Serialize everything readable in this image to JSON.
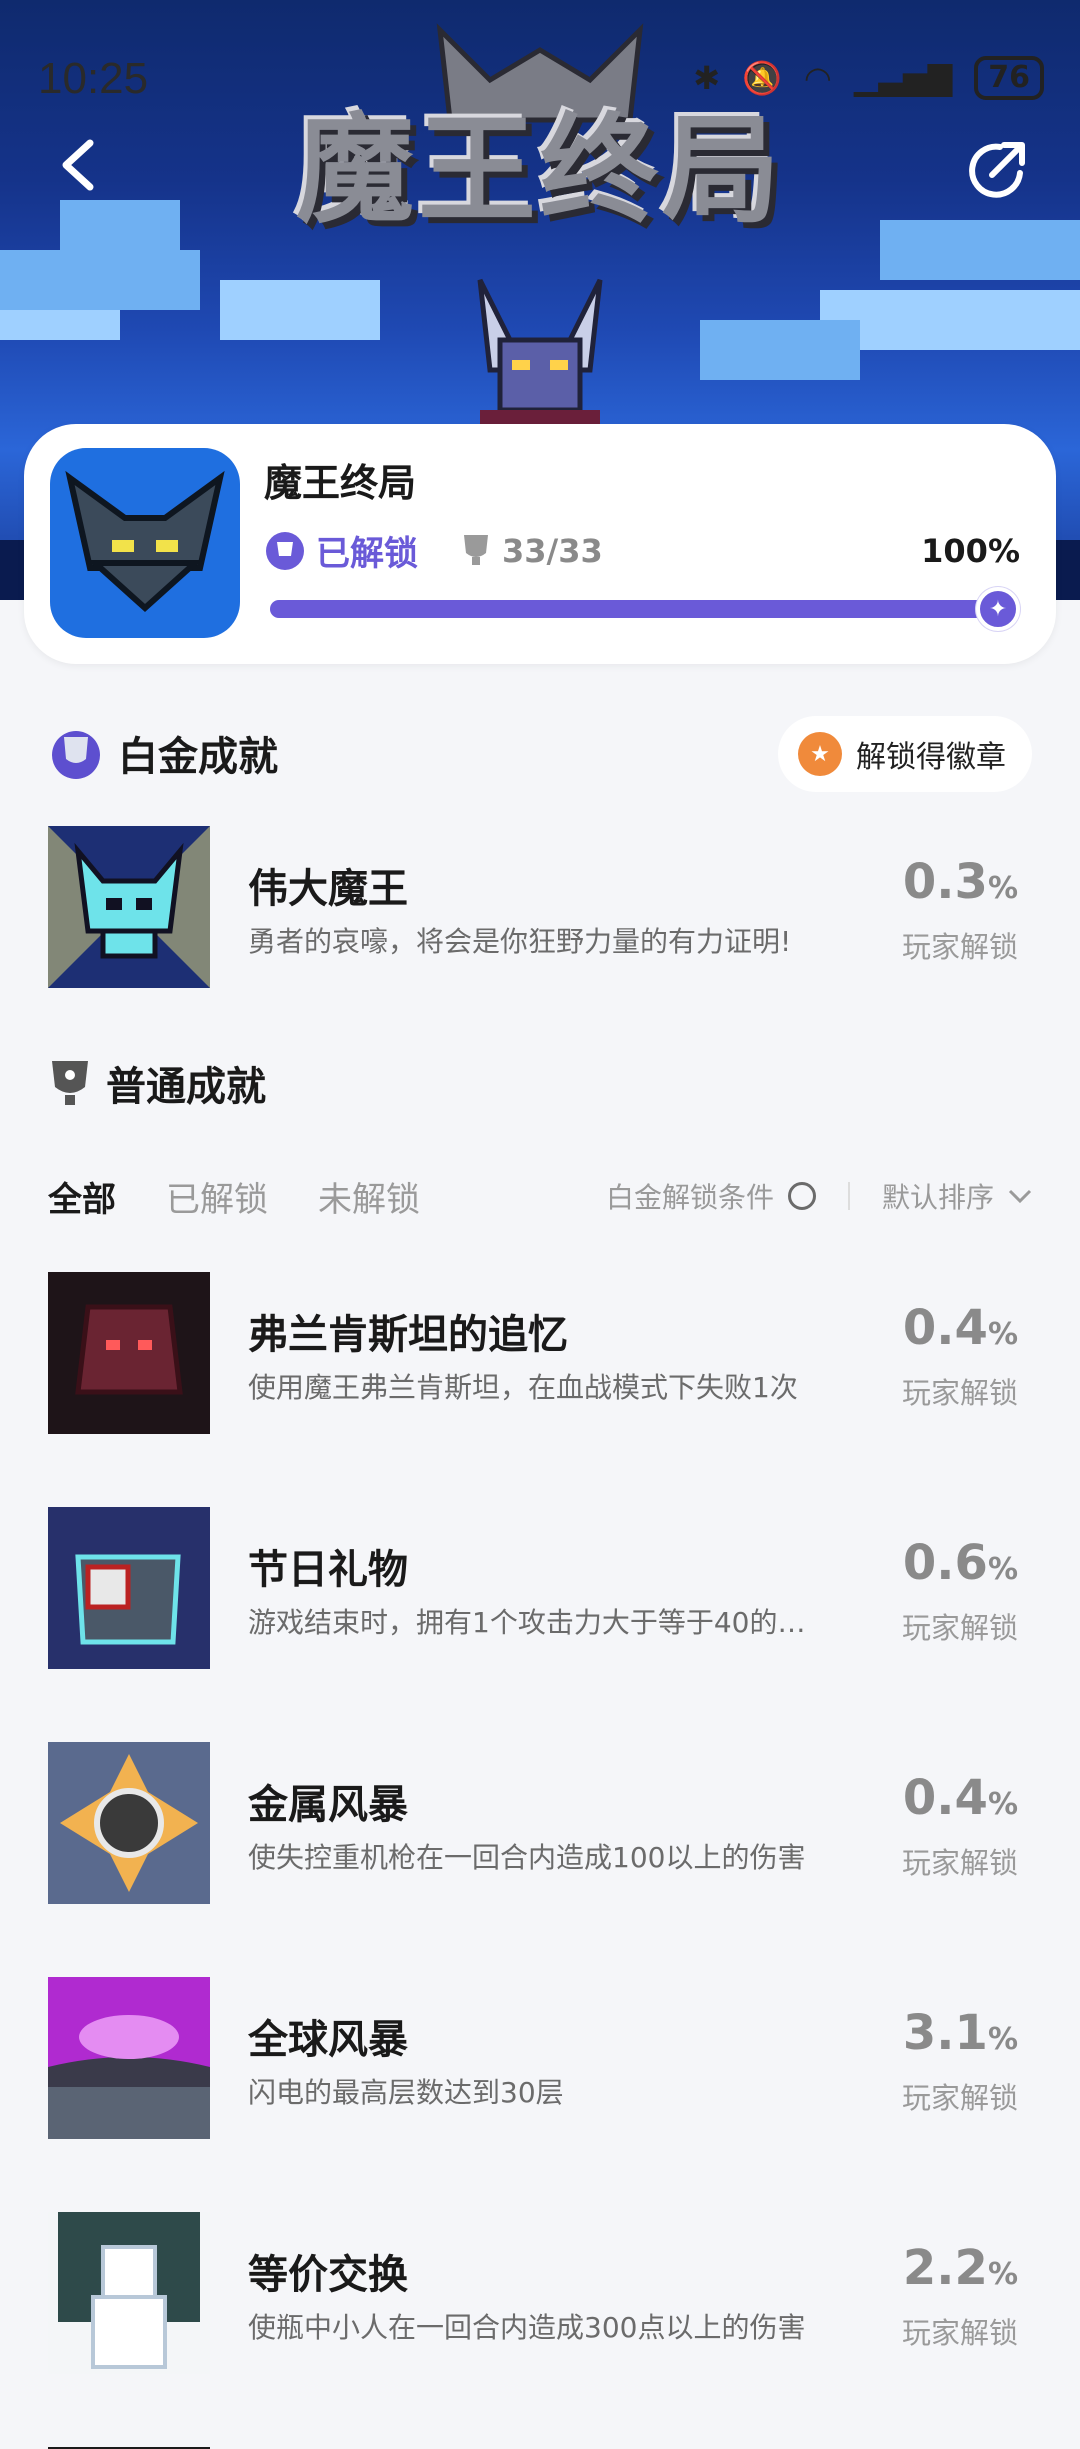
{
  "status_bar": {
    "time": "10:25",
    "battery": "76"
  },
  "hero": {
    "title": "魔王终局"
  },
  "card": {
    "title": "魔王终局",
    "unlocked_label": "已解锁",
    "trophies": "33/33",
    "percent": "100%",
    "progress": 1.0
  },
  "platinum": {
    "heading": "白金成就",
    "badge_button": "解锁得徽章",
    "item": {
      "name": "伟大魔王",
      "desc": "勇者的哀嚎，将会是你狂野力量的有力证明!",
      "rate": "0.3",
      "unit": "%",
      "label": "玩家解锁"
    }
  },
  "normal": {
    "heading": "普通成就",
    "tabs": [
      "全部",
      "已解锁",
      "未解锁"
    ],
    "condition_label": "白金解锁条件",
    "sort_label": "默认排序",
    "items": [
      {
        "name": "弗兰肯斯坦的追忆",
        "desc": "使用魔王弗兰肯斯坦，在血战模式下失败1次",
        "rate": "0.4",
        "unit": "%",
        "label": "玩家解锁"
      },
      {
        "name": "节日礼物",
        "desc": "游戏结束时，拥有1个攻击力大于等于40的…",
        "rate": "0.6",
        "unit": "%",
        "label": "玩家解锁"
      },
      {
        "name": "金属风暴",
        "desc": "使失控重机枪在一回合内造成100以上的伤害",
        "rate": "0.4",
        "unit": "%",
        "label": "玩家解锁"
      },
      {
        "name": "全球风暴",
        "desc": "闪电的最高层数达到30层",
        "rate": "3.1",
        "unit": "%",
        "label": "玩家解锁"
      },
      {
        "name": "等价交换",
        "desc": "使瓶中小人在一回合内造成300点以上的伤害",
        "rate": "2.2",
        "unit": "%",
        "label": "玩家解锁"
      }
    ]
  }
}
